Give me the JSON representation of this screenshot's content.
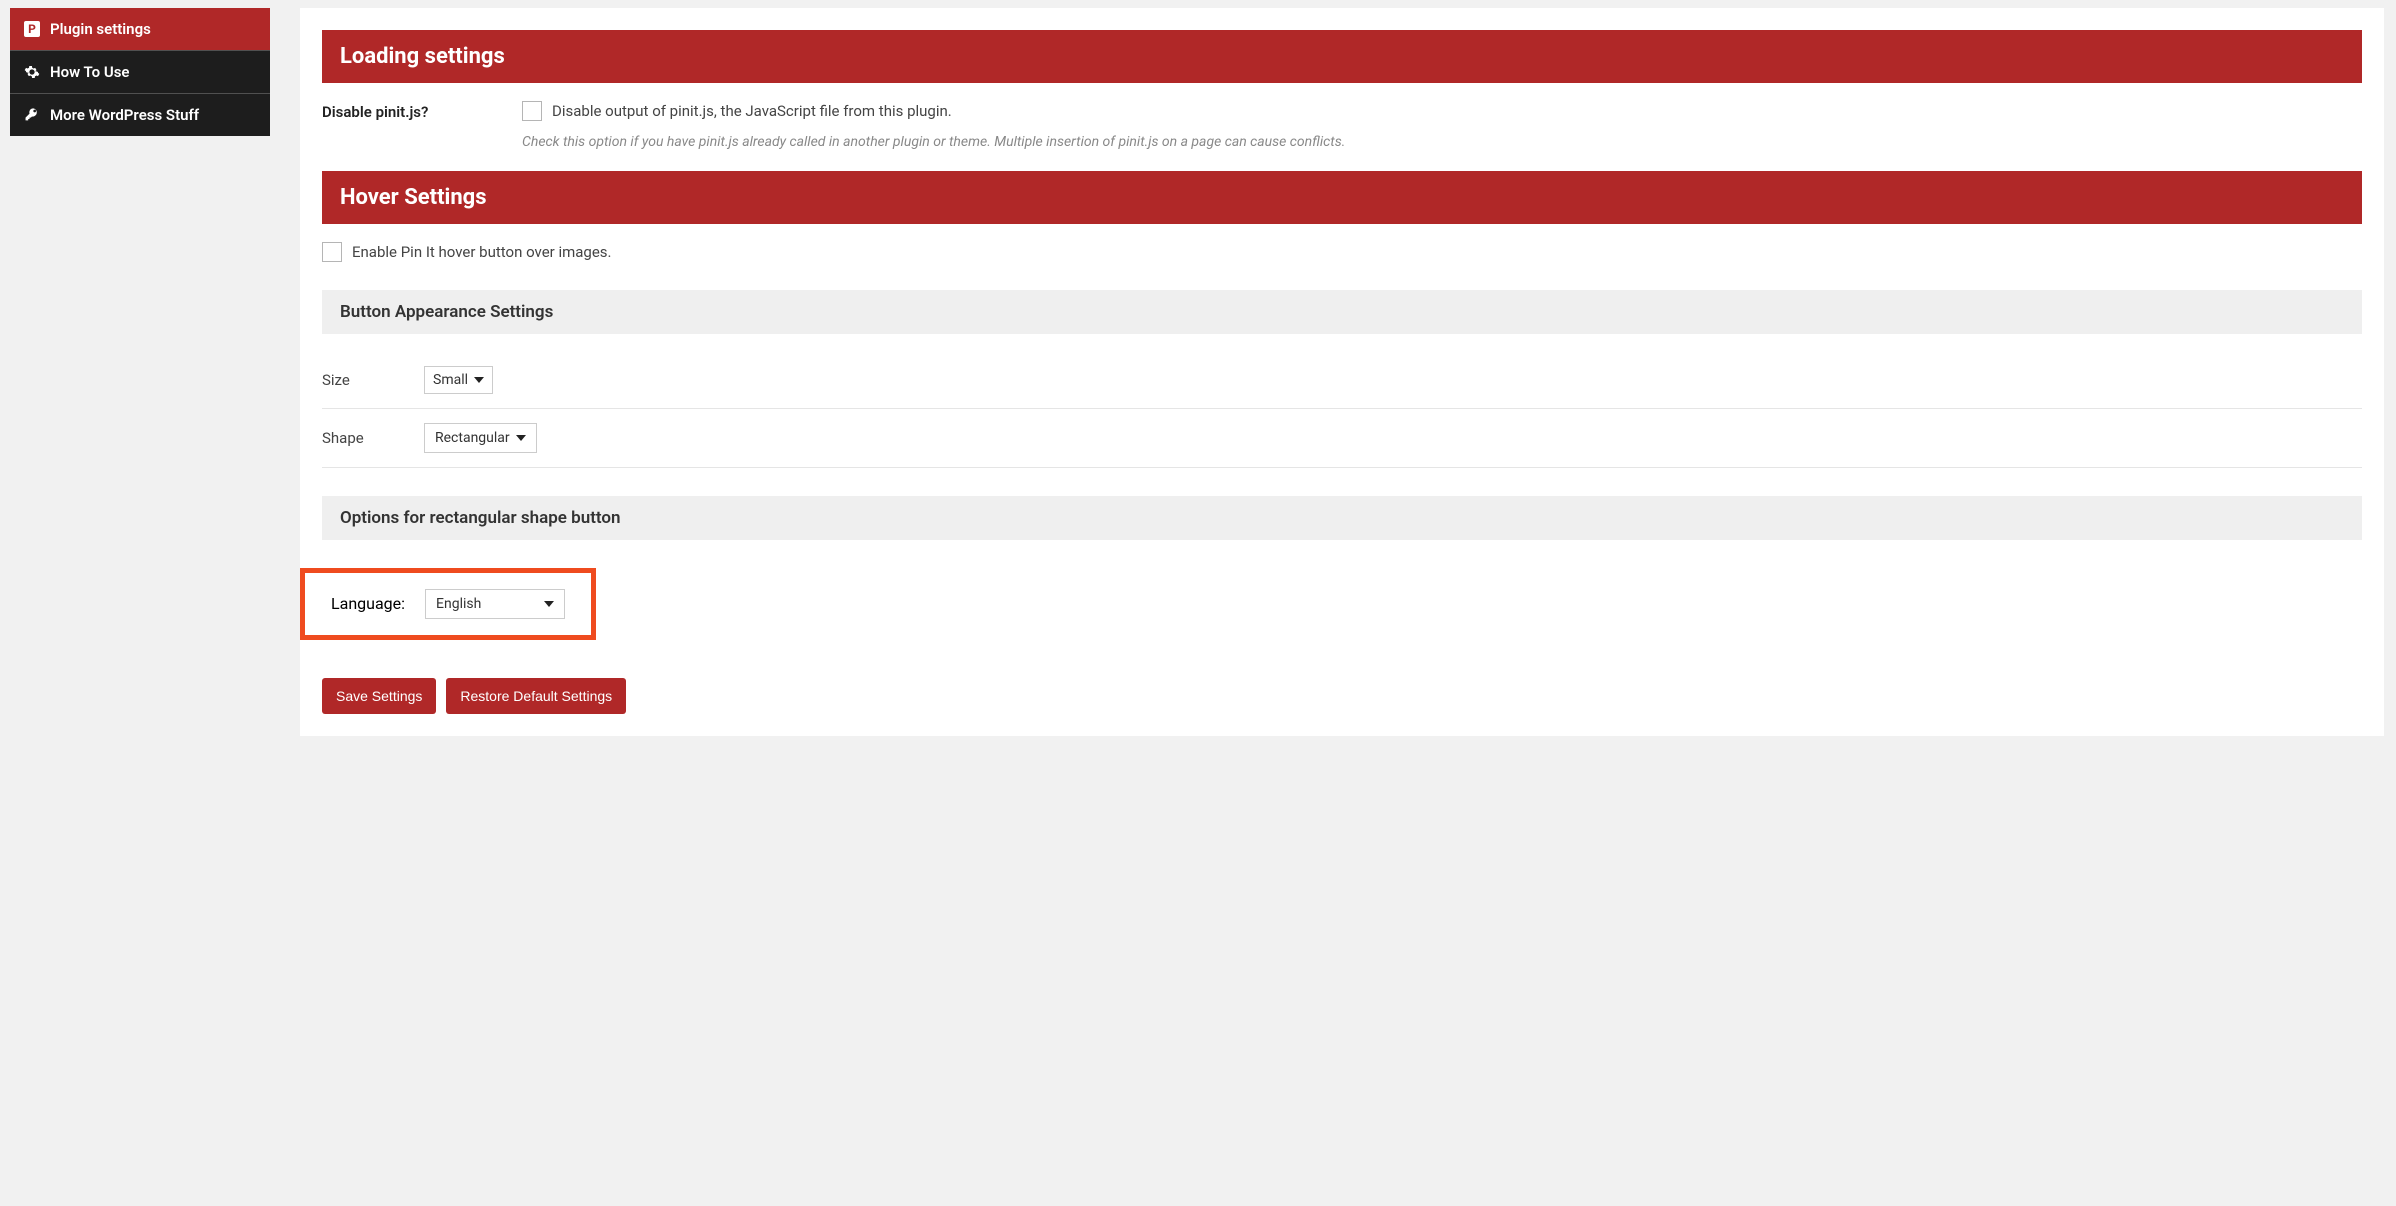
{
  "sidebar": {
    "items": [
      {
        "label": "Plugin settings",
        "icon": "pinterest"
      },
      {
        "label": "How To Use",
        "icon": "gear"
      },
      {
        "label": "More WordPress Stuff",
        "icon": "key"
      }
    ]
  },
  "sections": {
    "loading": {
      "title": "Loading settings",
      "field_label": "Disable pinit.js?",
      "checkbox_label": "Disable output of pinit.js, the JavaScript file from this plugin.",
      "help": "Check this option if you have pinit.js already called in another plugin or theme. Multiple insertion of pinit.js on a page can cause conflicts."
    },
    "hover": {
      "title": "Hover Settings",
      "enable_label": "Enable Pin It hover button over images.",
      "appearance_title": "Button Appearance Settings",
      "size_label": "Size",
      "size_value": "Small",
      "shape_label": "Shape",
      "shape_value": "Rectangular",
      "rect_options_title": "Options for rectangular shape button",
      "language_label": "Language:",
      "language_value": "English"
    }
  },
  "buttons": {
    "save": "Save Settings",
    "restore": "Restore Default Settings"
  }
}
